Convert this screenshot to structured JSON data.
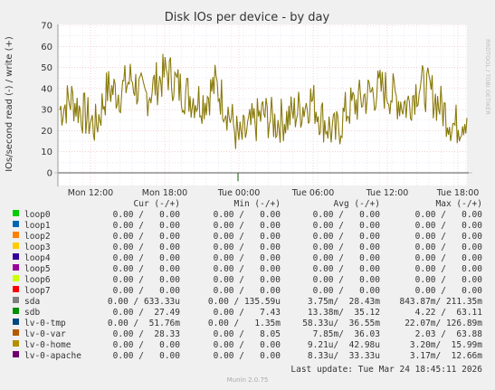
{
  "chart_data": {
    "type": "line",
    "title": "Disk IOs per device - by day",
    "ylabel": "IOs/second read (-) / write (+)",
    "watermark": "RRDTOOL / TOBI OETIKER",
    "ylim": [
      -5,
      70
    ],
    "yticks": [
      0,
      10,
      20,
      30,
      40,
      50,
      60,
      70
    ],
    "xticks": [
      "Mon 12:00",
      "Mon 18:00",
      "Tue 00:00",
      "Tue 06:00",
      "Tue 12:00",
      "Tue 18:00"
    ],
    "grid": true,
    "colors": {
      "lv_var_write": "#7a7a00",
      "lv_var_write_accent": "#b86c18",
      "zero_line": "#111111",
      "grid_major": "#f2b4b4",
      "grid_minor": "#dcdcf0"
    },
    "series": [
      {
        "name": "lv-0-var",
        "x": [
          "Mon 09:00",
          "Mon 10:00",
          "Mon 11:00",
          "Mon 12:00",
          "Mon 13:00",
          "Mon 14:00",
          "Mon 15:00",
          "Mon 16:00",
          "Mon 17:00",
          "Mon 18:00",
          "Mon 19:00",
          "Mon 20:00",
          "Mon 21:00",
          "Mon 22:00",
          "Mon 23:00",
          "Tue 00:00",
          "Tue 01:00",
          "Tue 02:00",
          "Tue 03:00",
          "Tue 04:00",
          "Tue 05:00",
          "Tue 06:00",
          "Tue 07:00",
          "Tue 08:00",
          "Tue 09:00",
          "Tue 10:00",
          "Tue 11:00",
          "Tue 12:00",
          "Tue 13:00",
          "Tue 14:00",
          "Tue 15:00",
          "Tue 16:00",
          "Tue 17:00",
          "Tue 18:00",
          "Tue 18:45"
        ],
        "values": [
          30,
          35,
          28,
          22,
          40,
          38,
          45,
          35,
          42,
          48,
          40,
          36,
          34,
          42,
          30,
          15,
          22,
          28,
          24,
          26,
          30,
          35,
          25,
          18,
          30,
          34,
          38,
          40,
          36,
          32,
          42,
          38,
          30,
          22,
          28
        ]
      }
    ]
  },
  "legend": {
    "header": {
      "cur": "Cur (-/+)",
      "min": "Min (-/+)",
      "avg": "Avg (-/+)",
      "max": "Max (-/+)"
    },
    "rows": [
      {
        "name": "loop0",
        "color": "#00cc00",
        "cur": "0.00 /   0.00",
        "min": "0.00 /   0.00",
        "avg": "0.00 /   0.00",
        "max": "0.00 /   0.00"
      },
      {
        "name": "loop1",
        "color": "#0066b3",
        "cur": "0.00 /   0.00",
        "min": "0.00 /   0.00",
        "avg": "0.00 /   0.00",
        "max": "0.00 /   0.00"
      },
      {
        "name": "loop2",
        "color": "#ff8000",
        "cur": "0.00 /   0.00",
        "min": "0.00 /   0.00",
        "avg": "0.00 /   0.00",
        "max": "0.00 /   0.00"
      },
      {
        "name": "loop3",
        "color": "#ffcc00",
        "cur": "0.00 /   0.00",
        "min": "0.00 /   0.00",
        "avg": "0.00 /   0.00",
        "max": "0.00 /   0.00"
      },
      {
        "name": "loop4",
        "color": "#330099",
        "cur": "0.00 /   0.00",
        "min": "0.00 /   0.00",
        "avg": "0.00 /   0.00",
        "max": "0.00 /   0.00"
      },
      {
        "name": "loop5",
        "color": "#990099",
        "cur": "0.00 /   0.00",
        "min": "0.00 /   0.00",
        "avg": "0.00 /   0.00",
        "max": "0.00 /   0.00"
      },
      {
        "name": "loop6",
        "color": "#ccff00",
        "cur": "0.00 /   0.00",
        "min": "0.00 /   0.00",
        "avg": "0.00 /   0.00",
        "max": "0.00 /   0.00"
      },
      {
        "name": "loop7",
        "color": "#ff0000",
        "cur": "0.00 /   0.00",
        "min": "0.00 /   0.00",
        "avg": "0.00 /   0.00",
        "max": "0.00 /   0.00"
      },
      {
        "name": "sda",
        "color": "#808080",
        "cur": "0.00 / 633.33u",
        "min": "0.00 / 135.59u",
        "avg": "3.75m/  28.43m",
        "max": "843.87m/ 211.35m"
      },
      {
        "name": "sdb",
        "color": "#008f00",
        "cur": "0.00 /  27.49",
        "min": "0.00 /   7.43",
        "avg": "13.38m/  35.12",
        "max": "4.22 /  63.11"
      },
      {
        "name": "lv-0-tmp",
        "color": "#00487d",
        "cur": "0.00 /  51.76m",
        "min": "0.00 /   1.35m",
        "avg": "58.33u/  36.55m",
        "max": "22.07m/ 126.89m"
      },
      {
        "name": "lv-0-var",
        "color": "#b35a00",
        "cur": "0.00 /  28.33",
        "min": "0.00 /   8.05",
        "avg": "7.85m/  36.03",
        "max": "2.03 /  63.88"
      },
      {
        "name": "lv-0-home",
        "color": "#b38f00",
        "cur": "0.00 /   0.00",
        "min": "0.00 /   0.00",
        "avg": "9.21u/  42.98u",
        "max": "3.20m/  15.99m"
      },
      {
        "name": "lv-0-apache",
        "color": "#6b006b",
        "cur": "0.00 /   0.00",
        "min": "0.00 /   0.00",
        "avg": "8.33u/  33.33u",
        "max": "3.17m/  12.66m"
      }
    ]
  },
  "last_update": "Last update: Tue Mar 24 18:45:11 2026",
  "footer": "Munin 2.0.75"
}
